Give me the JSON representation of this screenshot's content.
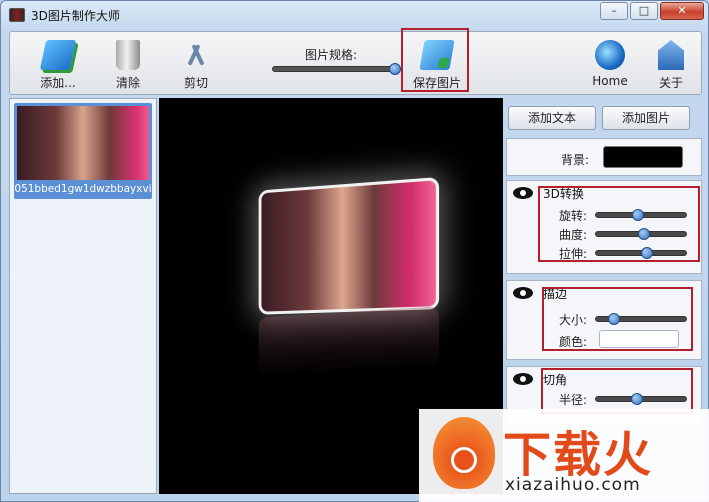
{
  "window": {
    "title": "3D图片制作大师",
    "minimize": "–",
    "maximize": "□",
    "close": "✕"
  },
  "toolbar": {
    "add_label": "添加...",
    "clear_label": "清除",
    "cut_label": "剪切",
    "size_label": "图片规格:",
    "size_value": 0.95,
    "save_label": "保存图片",
    "home_label": "Home",
    "about_label": "关于"
  },
  "thumbnails": [
    {
      "name": "051bbed1gw1dwzbbayxvi"
    }
  ],
  "right": {
    "add_text_label": "添加文本",
    "add_image_label": "添加图片",
    "background_label": "背景:",
    "background_color": "#000000",
    "transform3d": {
      "title": "3D转换",
      "rotate_label": "旋转:",
      "rotate_value": 0.47,
      "curve_label": "曲度:",
      "curve_value": 0.53,
      "stretch_label": "拉伸:",
      "stretch_value": 0.57
    },
    "stroke": {
      "title": "描边",
      "size_label": "大小:",
      "size_value": 0.2,
      "color_label": "颜色:",
      "color_value": "#ffffff"
    },
    "corner": {
      "title": "切角",
      "radius_label": "半径:",
      "radius_value": 0.45
    }
  },
  "watermark": {
    "brand_cn": "下载火",
    "brand_en": "xiazaihuo.com"
  },
  "colors": {
    "highlight": "#b51e2b",
    "accent": "#2f6fc0"
  }
}
